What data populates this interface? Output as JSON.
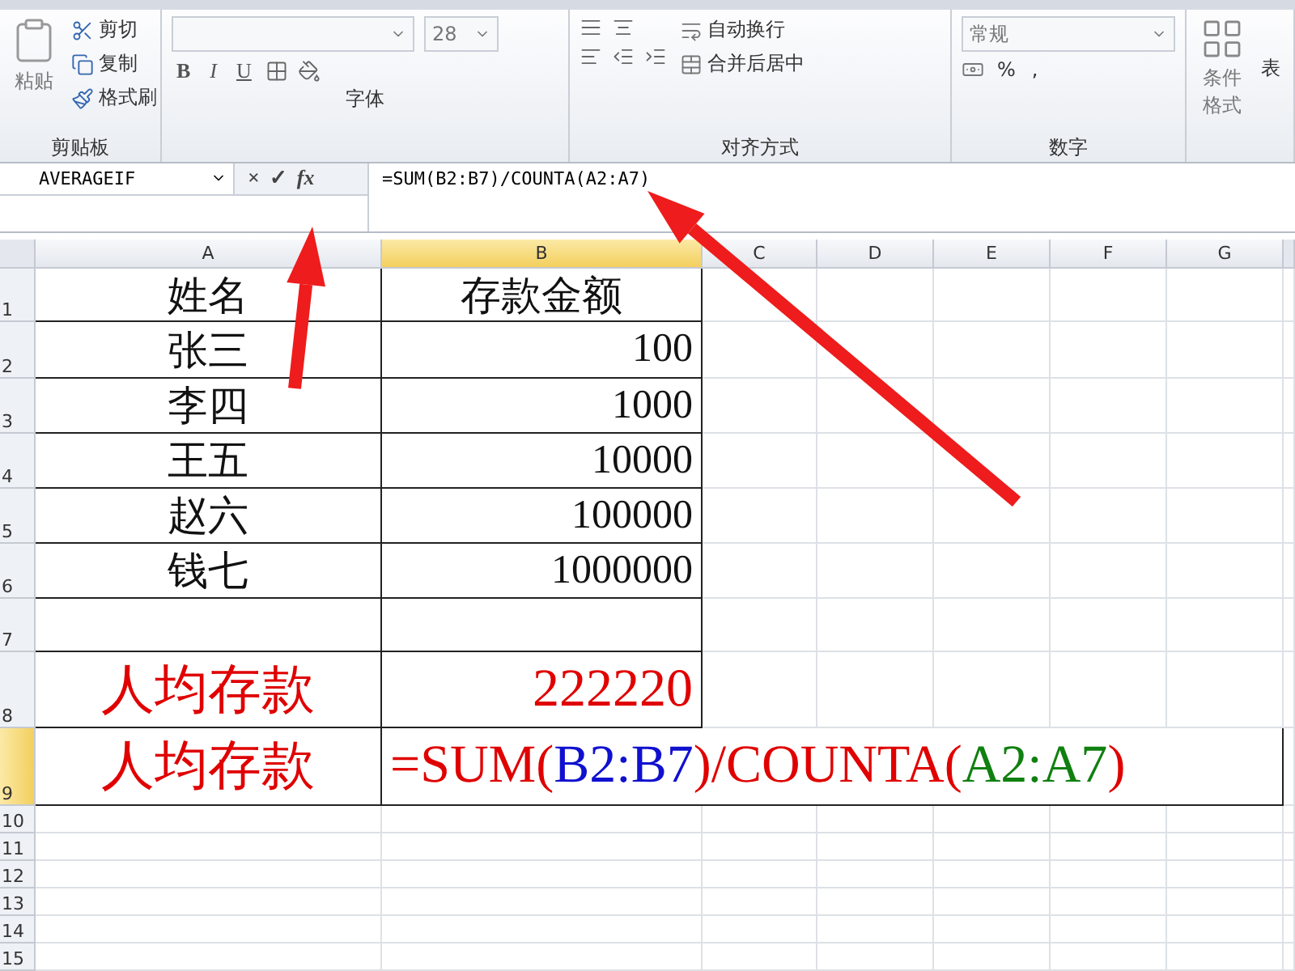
{
  "ribbon": {
    "groups": [
      {
        "kind": "clipboard",
        "label": "剪贴板",
        "paste": "粘贴",
        "items": [
          "剪切",
          "复制",
          "格式刷"
        ]
      },
      {
        "kind": "font",
        "label": "字体",
        "font_size": "28",
        "styles": [
          "B",
          "I",
          "U"
        ]
      },
      {
        "kind": "alignment",
        "label": "对齐方式",
        "wrap": "自动换行",
        "merge": "合并后居中"
      },
      {
        "kind": "number",
        "label": "数字",
        "format": "常规",
        "symbols": [
          "%",
          ","
        ]
      },
      {
        "kind": "styles",
        "label": "条件格式",
        "extra": "表"
      }
    ]
  },
  "formula_bar": {
    "name_box": "AVERAGEIF",
    "cancel": "×",
    "enter": "✓",
    "fx": "fx",
    "formula": "=SUM(B2:B7)/COUNTA(A2:A7)"
  },
  "sheet": {
    "columns": [
      {
        "label": "A",
        "selected": false
      },
      {
        "label": "B",
        "selected": true
      },
      {
        "label": "C",
        "selected": false
      },
      {
        "label": "D",
        "selected": false
      },
      {
        "label": "E",
        "selected": false
      },
      {
        "label": "F",
        "selected": false
      },
      {
        "label": "G",
        "selected": false
      }
    ],
    "rows": [
      {
        "number": "1",
        "selected": false,
        "cells": [
          {
            "kind": "header",
            "text": "姓名"
          },
          {
            "kind": "header",
            "text": "存款金额"
          }
        ]
      },
      {
        "number": "2",
        "selected": false,
        "cells": [
          {
            "kind": "name",
            "text": "张三"
          },
          {
            "kind": "amount",
            "text": "100"
          }
        ]
      },
      {
        "number": "3",
        "selected": false,
        "cells": [
          {
            "kind": "name",
            "text": "李四"
          },
          {
            "kind": "amount",
            "text": "1000"
          }
        ]
      },
      {
        "number": "4",
        "selected": false,
        "cells": [
          {
            "kind": "name",
            "text": "王五"
          },
          {
            "kind": "amount",
            "text": "10000"
          }
        ]
      },
      {
        "number": "5",
        "selected": false,
        "cells": [
          {
            "kind": "name",
            "text": "赵六"
          },
          {
            "kind": "amount",
            "text": "100000"
          }
        ]
      },
      {
        "number": "6",
        "selected": false,
        "cells": [
          {
            "kind": "name",
            "text": "钱七"
          },
          {
            "kind": "amount",
            "text": "1000000"
          }
        ]
      },
      {
        "number": "7",
        "selected": false,
        "cells": [
          {
            "kind": "name",
            "text": ""
          },
          {
            "kind": "amount",
            "text": ""
          }
        ]
      },
      {
        "number": "8",
        "selected": false,
        "cells": [
          {
            "kind": "label",
            "text": "人均存款"
          },
          {
            "kind": "result",
            "text": "222220"
          }
        ]
      },
      {
        "number": "9",
        "selected": true,
        "cells": [
          {
            "kind": "label",
            "text": "人均存款"
          },
          {
            "kind": "formula",
            "segments": [
              {
                "text": "=SUM(",
                "color": "#e00000"
              },
              {
                "text": "B2:B7",
                "color": "#1010d0"
              },
              {
                "text": ")/COUNTA(",
                "color": "#e00000"
              },
              {
                "text": "A2:A7",
                "color": "#108010"
              },
              {
                "text": ")",
                "color": "#e00000"
              }
            ]
          }
        ]
      },
      {
        "number": "10",
        "selected": false,
        "cells": []
      },
      {
        "number": "11",
        "selected": false,
        "cells": []
      },
      {
        "number": "12",
        "selected": false,
        "cells": []
      },
      {
        "number": "13",
        "selected": false,
        "cells": []
      },
      {
        "number": "14",
        "selected": false,
        "cells": []
      },
      {
        "number": "15",
        "selected": false,
        "cells": []
      }
    ]
  }
}
